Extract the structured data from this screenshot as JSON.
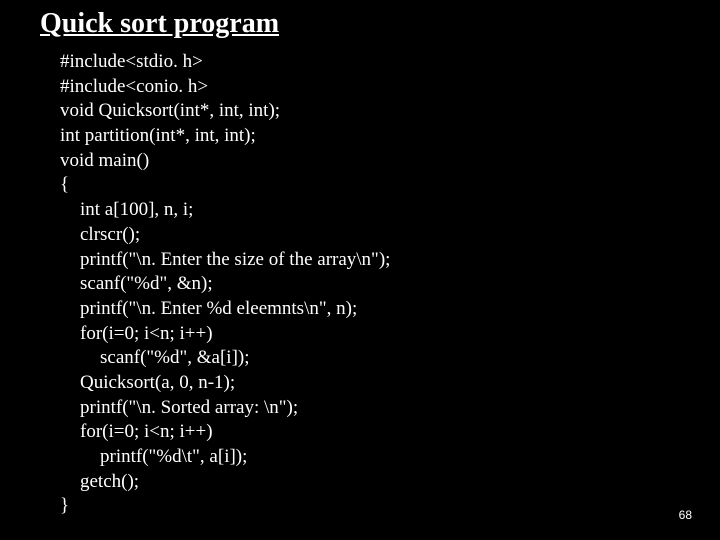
{
  "title": "Quick sort program",
  "code": {
    "l0": "#include<stdio. h>",
    "l1": "#include<conio. h>",
    "l2": "void Quicksort(int*, int, int);",
    "l3": "int partition(int*, int, int);",
    "l4": "void main()",
    "l5": "{",
    "l6": "int a[100], n, i;",
    "l7": "clrscr();",
    "l8": "printf(\"\\n. Enter the size of the array\\n\");",
    "l9": "scanf(\"%d\", &n);",
    "l10": "printf(\"\\n. Enter %d eleemnts\\n\", n);",
    "l11": "for(i=0; i<n; i++)",
    "l12": "scanf(\"%d\", &a[i]);",
    "l13": "Quicksort(a, 0, n-1);",
    "l14": "printf(\"\\n. Sorted array: \\n\");",
    "l15": "for(i=0; i<n; i++)",
    "l16": "printf(\"%d\\t\", a[i]);",
    "l17": "getch();",
    "l18": "}"
  },
  "page_number": "68"
}
